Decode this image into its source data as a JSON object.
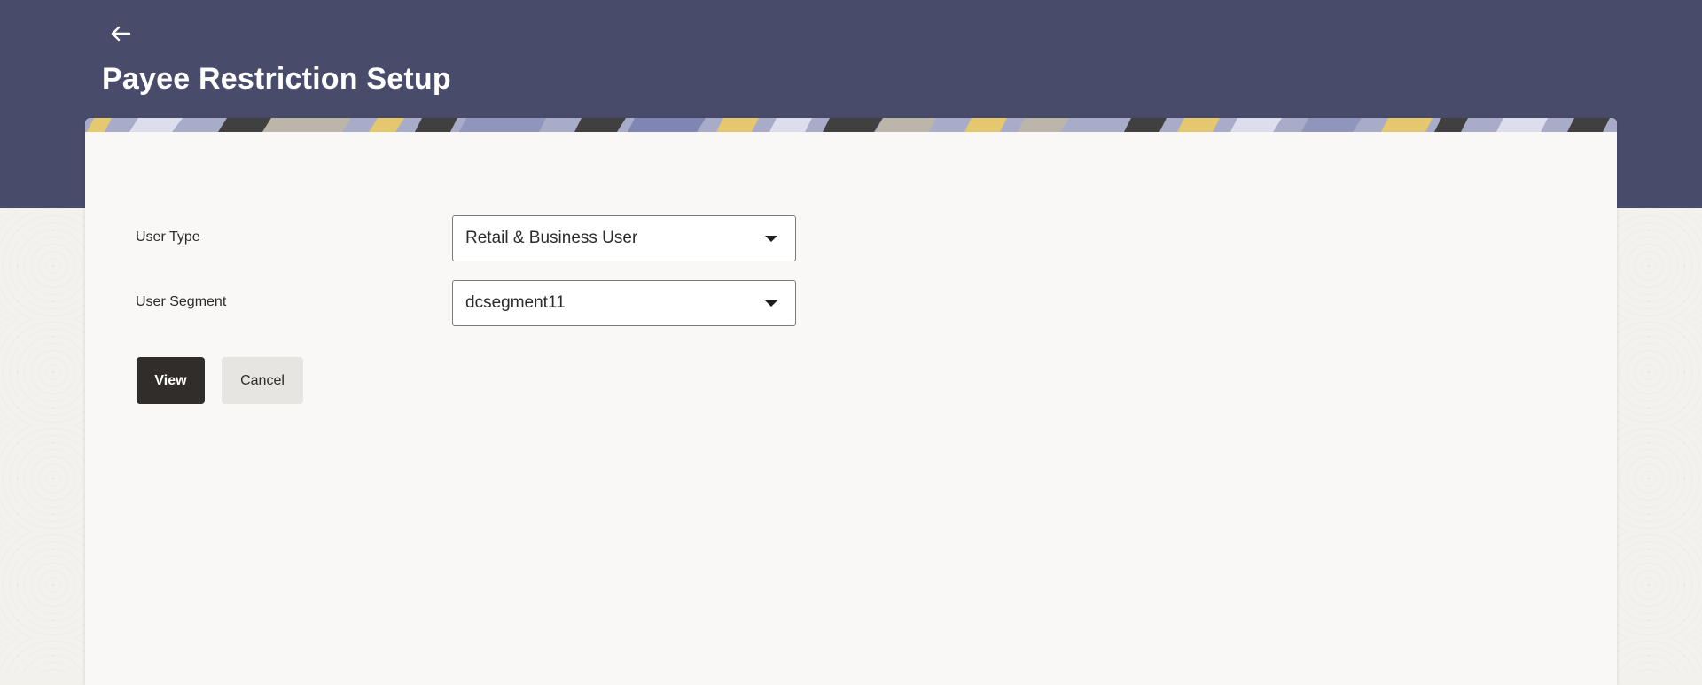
{
  "page": {
    "title": "Payee Restriction Setup",
    "back_icon": "arrow-left-icon"
  },
  "form": {
    "user_type": {
      "label": "User Type",
      "value": "Retail & Business User"
    },
    "user_segment": {
      "label": "User Segment",
      "value": "dcsegment11"
    }
  },
  "actions": {
    "view_label": "View",
    "cancel_label": "Cancel"
  },
  "colors": {
    "header_bg": "#484c6a",
    "primary_button": "#312d2a",
    "secondary_button": "#e6e5e2"
  }
}
